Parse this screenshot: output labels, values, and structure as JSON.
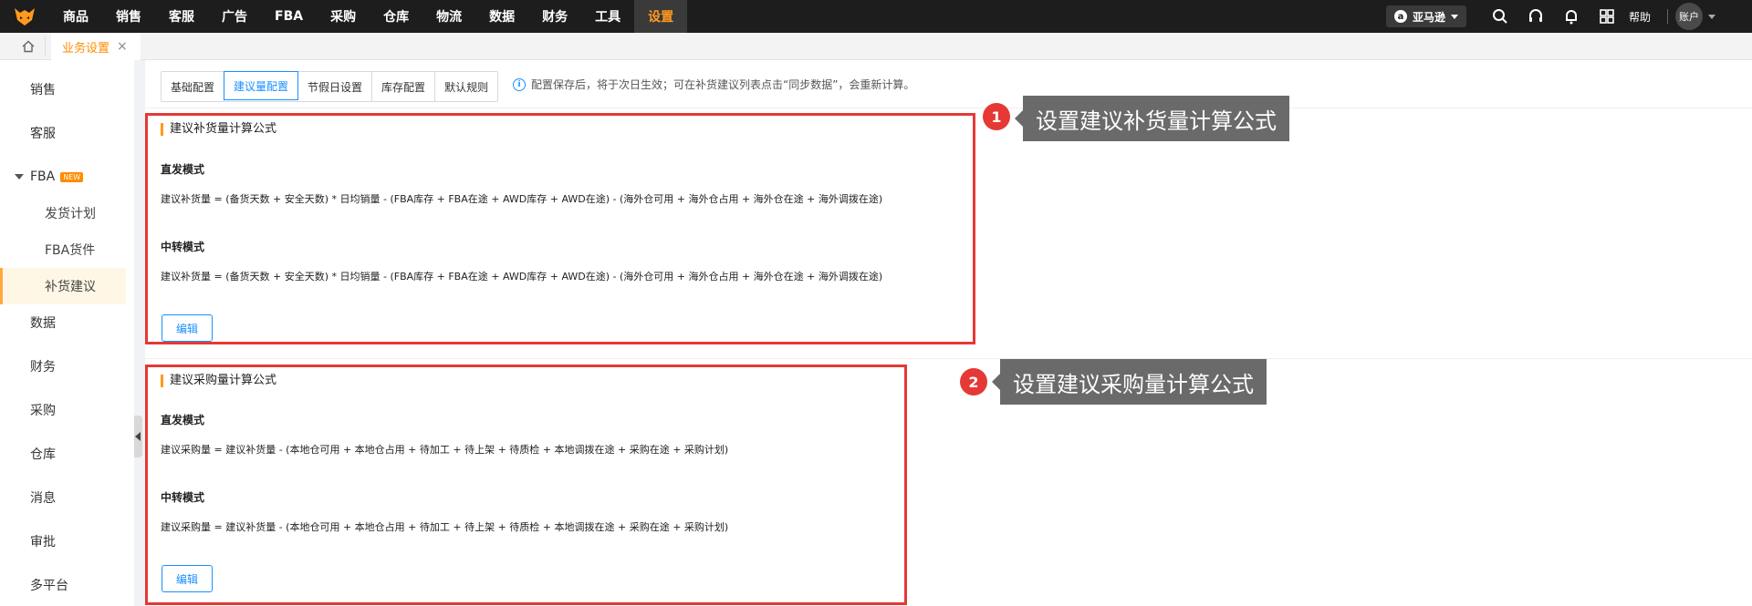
{
  "topnav": {
    "items": [
      {
        "label": "商品"
      },
      {
        "label": "销售"
      },
      {
        "label": "客服"
      },
      {
        "label": "广告"
      },
      {
        "label": "FBA"
      },
      {
        "label": "采购"
      },
      {
        "label": "仓库"
      },
      {
        "label": "物流"
      },
      {
        "label": "数据"
      },
      {
        "label": "财务"
      },
      {
        "label": "工具"
      },
      {
        "label": "设置"
      }
    ],
    "active": "设置",
    "marketplace": "亚马逊",
    "help_label": "帮助",
    "account_label": "账户",
    "icons": [
      "search-icon",
      "headset-icon",
      "bell-icon",
      "apps-icon"
    ]
  },
  "tabbar": {
    "tab_label": "业务设置",
    "close_glyph": "×"
  },
  "sidebar": {
    "items": [
      {
        "label": "销售"
      },
      {
        "label": "客服"
      },
      {
        "label": "FBA",
        "badge": "NEW"
      },
      {
        "label": "发货计划"
      },
      {
        "label": "FBA货件"
      },
      {
        "label": "补货建议"
      },
      {
        "label": "数据"
      },
      {
        "label": "财务"
      },
      {
        "label": "采购"
      },
      {
        "label": "仓库"
      },
      {
        "label": "消息"
      },
      {
        "label": "审批"
      },
      {
        "label": "多平台"
      }
    ],
    "active": "补货建议"
  },
  "subtabs": {
    "items": [
      {
        "label": "基础配置"
      },
      {
        "label": "建议量配置"
      },
      {
        "label": "节假日设置"
      },
      {
        "label": "库存配置"
      },
      {
        "label": "默认规则"
      }
    ],
    "active": "建议量配置"
  },
  "notice": {
    "icon": "info-icon",
    "text": "配置保存后，将于次日生效；可在补货建议列表点击“同步数据”，会重新计算。"
  },
  "sections": [
    {
      "title": "建议补货量计算公式",
      "modes": [
        {
          "label": "直发模式",
          "formula": "建议补货量 = (备货天数 + 安全天数) * 日均销量 - (FBA库存 + FBA在途 + AWD库存 + AWD在途) - (海外仓可用 + 海外仓占用 + 海外仓在途 + 海外调拨在途)"
        },
        {
          "label": "中转模式",
          "formula": "建议补货量 = (备货天数 + 安全天数) * 日均销量 - (FBA库存 + FBA在途 + AWD库存 + AWD在途) - (海外仓可用 + 海外仓占用 + 海外仓在途 + 海外调拨在途)"
        }
      ],
      "edit_label": "编辑"
    },
    {
      "title": "建议采购量计算公式",
      "modes": [
        {
          "label": "直发模式",
          "formula": "建议采购量 = 建议补货量 - (本地仓可用 + 本地仓占用 + 待加工 + 待上架 + 待质检 + 本地调拨在途 + 采购在途 + 采购计划)"
        },
        {
          "label": "中转模式",
          "formula": "建议采购量 = 建议补货量 - (本地仓可用 + 本地仓占用 + 待加工 + 待上架 + 待质检 + 本地调拨在途 + 采购在途 + 采购计划)"
        }
      ],
      "edit_label": "编辑"
    }
  ],
  "annotations": [
    {
      "number": "1",
      "text": "设置建议补货量计算公式"
    },
    {
      "number": "2",
      "text": "设置建议采购量计算公式"
    }
  ],
  "colors": {
    "accent": "#ff9a1f",
    "primary": "#1890ff",
    "highlight": "#e53935",
    "topnav_bg": "#1d1d1d"
  }
}
